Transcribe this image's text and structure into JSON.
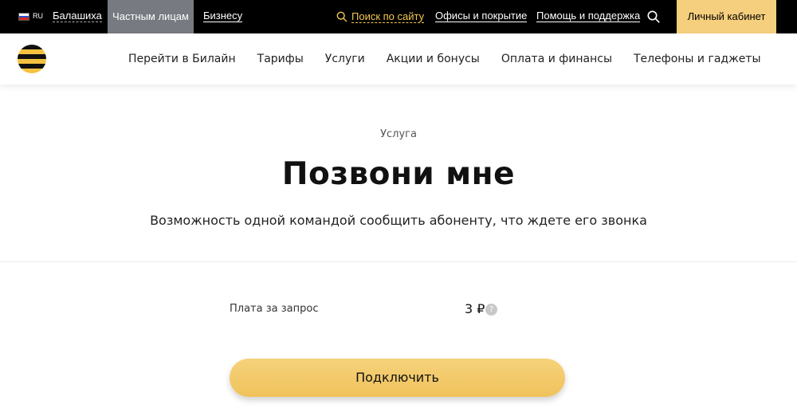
{
  "topbar": {
    "lang": "RU",
    "city": "Балашиха",
    "private": "Частным лицам",
    "business": "Бизнесу",
    "search": "Поиск по сайту",
    "offices": "Офисы и покрытие",
    "help": "Помощь и поддержка",
    "cabinet": "Личный кабинет"
  },
  "nav": {
    "items": [
      "Перейти в Билайн",
      "Тарифы",
      "Услуги",
      "Акции и бонусы",
      "Оплата и финансы",
      "Телефоны и гаджеты"
    ]
  },
  "hero": {
    "kicker": "Услуга",
    "title": "Позвони мне",
    "subtitle": "Возможность одной командой сообщить абоненту, что ждете его звонка"
  },
  "price": {
    "label": "Плата за запрос",
    "value": "3 ₽",
    "help": "?"
  },
  "connect_label": "Подключить",
  "colors": {
    "accent_yellow": "#f5cf7d",
    "topbar_bg": "#000000",
    "active_segment": "#777a80"
  }
}
